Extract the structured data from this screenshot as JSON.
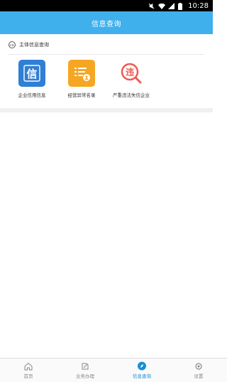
{
  "status_bar": {
    "time": "10:28"
  },
  "header": {
    "title": "信息查询"
  },
  "section": {
    "title": "主体信息查询",
    "icon": "qr-scan-icon"
  },
  "tiles": [
    {
      "label": "企业信用信息",
      "icon": "credit-info-icon",
      "glyph": "信",
      "color": "#2f7fd6"
    },
    {
      "label": "经营异常名录",
      "icon": "abnormal-list-icon",
      "color": "#f5a623"
    },
    {
      "label": "严重违法失信企业",
      "icon": "serious-violation-icon",
      "glyph": "违",
      "color": "#ee5a52"
    }
  ],
  "bottom_nav": [
    {
      "label": "首页",
      "icon": "home-icon",
      "active": false
    },
    {
      "label": "业务办理",
      "icon": "edit-icon",
      "active": false
    },
    {
      "label": "信息查询",
      "icon": "search-compass-icon",
      "active": true
    },
    {
      "label": "设置",
      "icon": "settings-icon",
      "active": false
    }
  ],
  "accent_color": "#3fb0ec"
}
